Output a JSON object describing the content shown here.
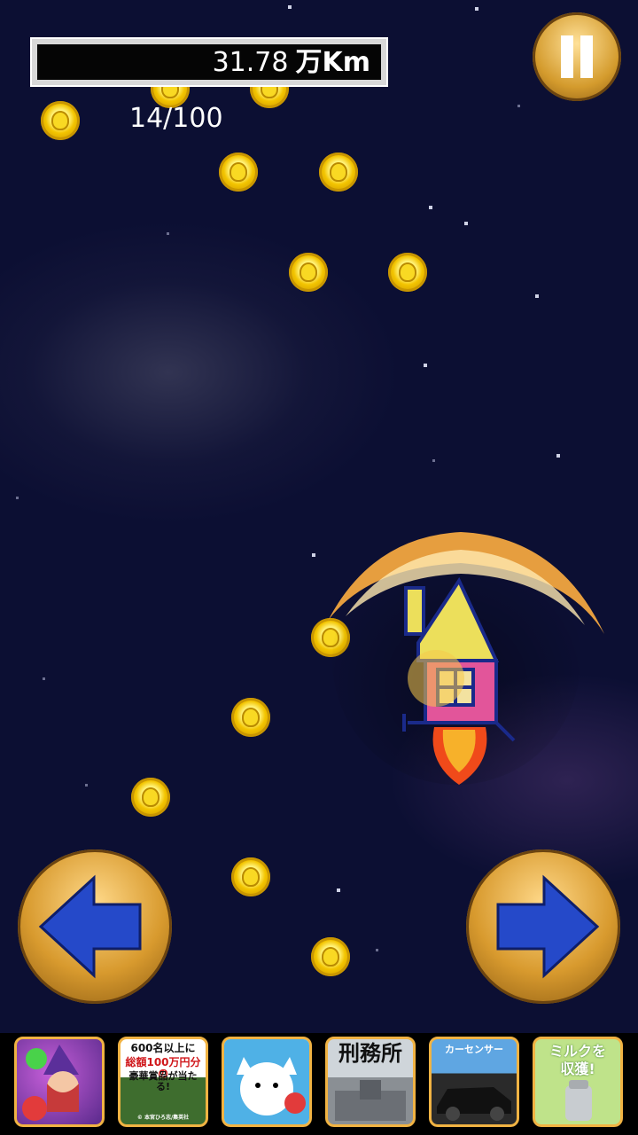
{
  "hud": {
    "distance_value": "31.78",
    "distance_unit": "万Km",
    "coin_count": "14/100",
    "coin_icon": "coin-icon"
  },
  "controls": {
    "pause_icon": "pause-icon",
    "left_icon": "left-arrow-icon",
    "right_icon": "right-arrow-icon"
  },
  "ads": [
    {
      "name": "ad-witch-bubble",
      "text": ""
    },
    {
      "name": "ad-prize",
      "line1": "600名以上に",
      "line2": "総額100万円分の",
      "line3": "豪華賞品が当たる!",
      "footer": "© 本宮ひろ志/集英社"
    },
    {
      "name": "ad-cat-game",
      "text": ""
    },
    {
      "name": "ad-prison",
      "text": "刑務所"
    },
    {
      "name": "ad-car-sensor",
      "text": "カーセンサー"
    },
    {
      "name": "ad-milk",
      "line1": "ミルクを",
      "line2": "収獲!"
    }
  ],
  "colors": {
    "background": "#0c0f33",
    "button_gold": "#d89a2e",
    "arrow_blue": "#2549c9",
    "coin_gold": "#f3c400"
  }
}
